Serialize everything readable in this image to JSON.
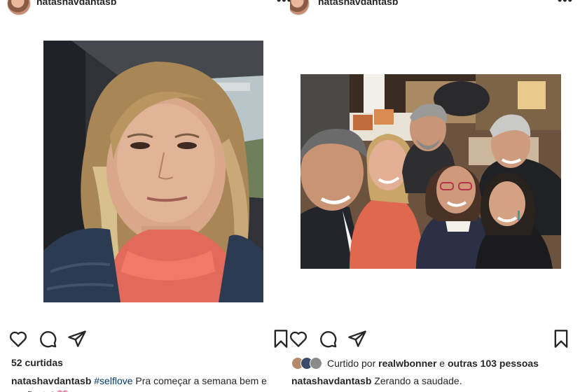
{
  "left_post": {
    "username": "natashavdantasb",
    "more": "•••",
    "likes": "52 curtidas",
    "caption_user": "natashavdantasb",
    "caption_hashtag": "#selflove",
    "caption_text": "Pra começar a semana bem e confiante!",
    "caption_emoji": "💗"
  },
  "right_post": {
    "username": "natashavdantasb",
    "more": "•••",
    "liked_prefix": "Curtido por",
    "liked_user": "realwbonner",
    "liked_middle": "e",
    "liked_others": "outras 103 pessoas",
    "caption_user": "natashavdantasb",
    "caption_text": "Zerando a saudade."
  },
  "icons": [
    "heart-icon",
    "comment-icon",
    "share-icon",
    "bookmark-icon",
    "more-icon"
  ]
}
